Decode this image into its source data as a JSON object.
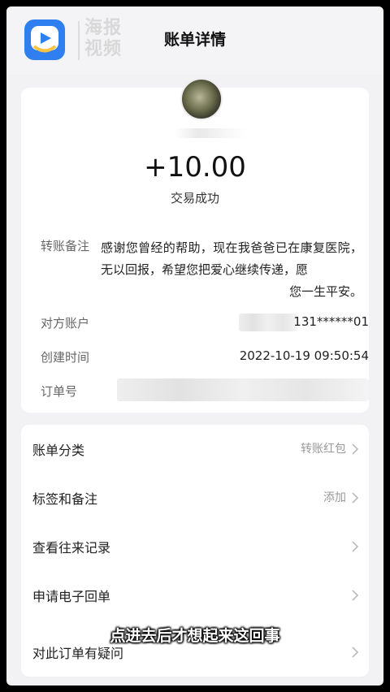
{
  "header": {
    "watermark_line1": "海报",
    "watermark_line2": "视频",
    "title": "账单详情"
  },
  "transaction": {
    "amount": "+10.00",
    "status": "交易成功"
  },
  "details": {
    "remark_label": "转账备注",
    "remark_text_main": "感谢您曾经的帮助，现在我爸爸已在康复医院，无以回报，希望您把爱心继续传递，愿",
    "remark_text_last": "您一生平安。",
    "account_label": "对方账户",
    "account_value": "131******01",
    "time_label": "创建时间",
    "time_value": "2022-10-19 09:50:54",
    "order_label": "订单号"
  },
  "menu": {
    "items": [
      {
        "label": "账单分类",
        "value": "转账红包"
      },
      {
        "label": "标签和备注",
        "value": "添加"
      },
      {
        "label": "查看往来记录",
        "value": ""
      },
      {
        "label": "申请电子回单",
        "value": ""
      },
      {
        "label": "对此订单有疑问",
        "value": ""
      }
    ]
  },
  "caption": "点进去后才想起来这回事",
  "colors": {
    "logo_blue": "#2f7ff0",
    "page_bg": "#f2f2f4"
  }
}
